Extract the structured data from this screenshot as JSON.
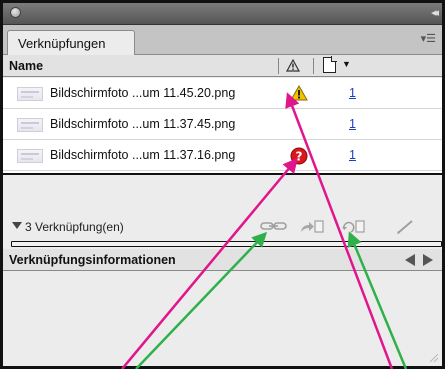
{
  "panel": {
    "tab_label": "Verknüpfungen",
    "menu_icon": "panel-menu-icon",
    "collapse_icon": "collapse-icon"
  },
  "columns": {
    "name_header": "Name",
    "status_icon": "warning-icon",
    "page_icon": "page-icon"
  },
  "links": [
    {
      "name": "Bildschirmfoto ...um 11.45.20.png",
      "status": "modified",
      "status_icon": "warning-icon",
      "page": "1"
    },
    {
      "name": "Bildschirmfoto ...um 11.37.45.png",
      "status": "ok",
      "status_icon": "",
      "page": "1"
    },
    {
      "name": "Bildschirmfoto ...um 11.37.16.png",
      "status": "missing",
      "status_icon": "missing-question-icon",
      "page": "1"
    }
  ],
  "info_bar": {
    "count_label": "3 Verknüpfung(en)",
    "tools": [
      "relink-chain-icon",
      "goto-link-icon",
      "update-link-icon",
      "edit-original-icon"
    ]
  },
  "link_info": {
    "title": "Verknüpfungsinformationen",
    "prev_icon": "previous-arrow-icon",
    "next_icon": "next-arrow-icon"
  },
  "annotation_colors": {
    "magenta": "#e0168c",
    "green": "#2fb04a"
  }
}
